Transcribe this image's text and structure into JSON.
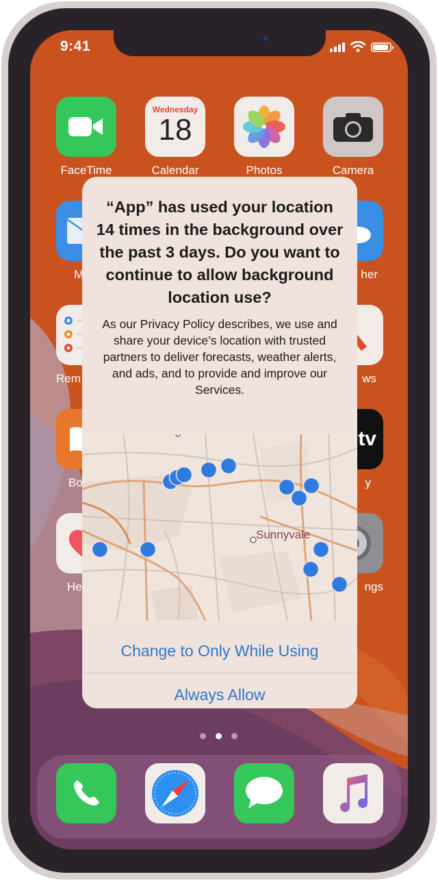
{
  "status_bar": {
    "time": "9:41"
  },
  "home_screen": {
    "apps": [
      {
        "name": "FaceTime",
        "icon": "facetime-icon"
      },
      {
        "name": "Calendar",
        "icon": "calendar-icon",
        "weekday": "Wednesday",
        "day": "18"
      },
      {
        "name": "Photos",
        "icon": "photos-icon"
      },
      {
        "name": "Camera",
        "icon": "camera-icon"
      }
    ],
    "partial_labels": {
      "mail": "M",
      "weather": "her",
      "reminders": "Rem",
      "news": "ws",
      "books": "Bo",
      "tv": "y",
      "health": "He",
      "settings": "ngs",
      "tv_icon_text": "tv"
    },
    "page_count": 3,
    "active_page": 2
  },
  "dock": {
    "apps": [
      {
        "name": "Phone",
        "icon": "phone-icon"
      },
      {
        "name": "Safari",
        "icon": "safari-icon"
      },
      {
        "name": "Messages",
        "icon": "messages-icon"
      },
      {
        "name": "Music",
        "icon": "music-icon"
      }
    ]
  },
  "alert": {
    "title": "“App” has used your location 14 times in the background over the past 3 days. Do you want to continue to allow background location use?",
    "message": "As our Privacy Policy describes, we use and share your device’s location with trusted partners to deliver forecasts, weather alerts, and ads, and to provide and improve our Services.",
    "map": {
      "place_label": "Sunnyvale",
      "location_points": 14
    },
    "buttons": {
      "change": "Change to Only While Using",
      "allow": "Always Allow"
    }
  },
  "colors": {
    "wallpaper_orange": "#c9521f",
    "alert_background": "#f0e2dc",
    "button_blue": "#2f78c9",
    "location_dot": "#2e7be0"
  }
}
